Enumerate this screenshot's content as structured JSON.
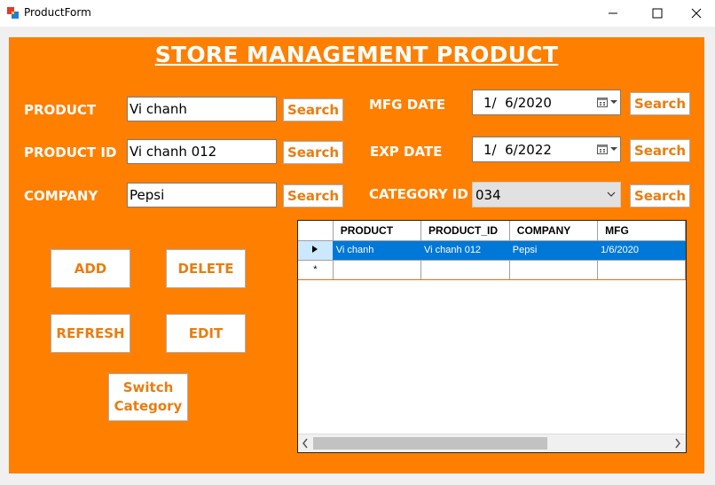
{
  "window": {
    "title": "ProductForm"
  },
  "form": {
    "heading": "STORE MANAGEMENT PRODUCT",
    "product_label": "PRODUCT",
    "product_value": "Vi chanh",
    "product_id_label": "PRODUCT ID",
    "product_id_value": "Vi chanh 012",
    "company_label": "COMPANY",
    "company_value": "Pepsi",
    "mfg_date_label": "MFG DATE",
    "mfg_date_value": "1/  6/2020",
    "exp_date_label": "EXP DATE",
    "exp_date_value": "1/  6/2022",
    "category_id_label": "CATEGORY ID",
    "category_id_value": "034",
    "search_label": "Search",
    "add_label": "ADD",
    "delete_label": "DELETE",
    "refresh_label": "REFRESH",
    "edit_label": "EDIT",
    "switch_category_line1": "Switch",
    "switch_category_line2": "Category"
  },
  "grid": {
    "columns": [
      "PRODUCT",
      "PRODUCT_ID",
      "COMPANY",
      "MFG"
    ],
    "rows": [
      [
        "Vi chanh",
        "Vi chanh 012",
        "Pepsi",
        "1/6/2020"
      ]
    ],
    "new_row_marker": "*"
  },
  "colors": {
    "form_background": "#ff7f00",
    "button_text": "#e87d11",
    "selection": "#0078d7"
  },
  "icons": {
    "app": "form-app-icon",
    "calendar": "calendar-icon",
    "dropdown": "chevron-down-icon",
    "row_pointer": "row-pointer-icon"
  }
}
